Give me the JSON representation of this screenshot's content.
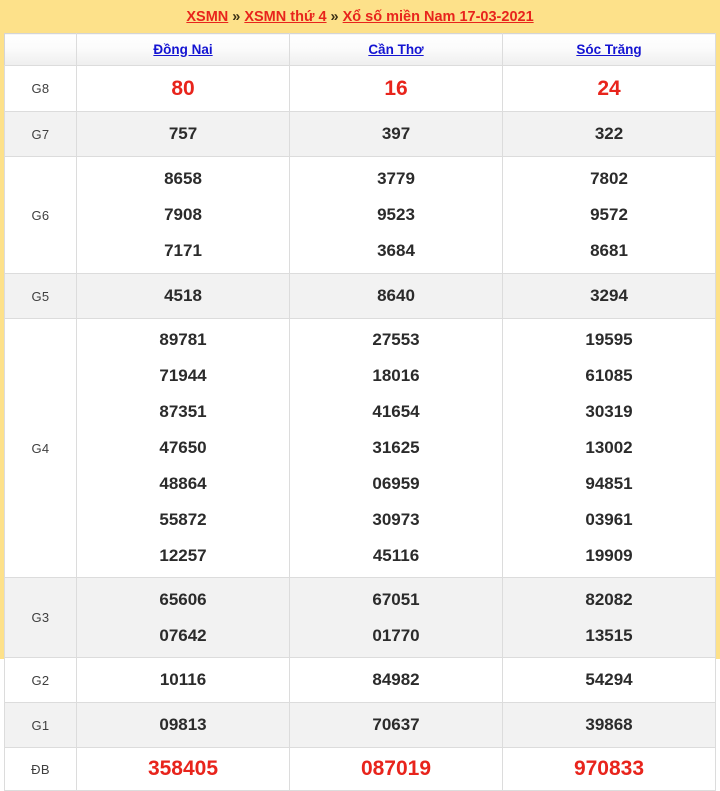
{
  "header": {
    "breadcrumb": [
      {
        "label": "XSMN",
        "type": "link"
      },
      {
        "label": "»",
        "type": "separator"
      },
      {
        "label": "XSMN thứ 4",
        "type": "link"
      },
      {
        "label": "»",
        "type": "separator"
      },
      {
        "label": "Xổ số miền Nam 17-03-2021",
        "type": "link"
      }
    ],
    "background_color": "#fde18a",
    "link_color": "#e8241c"
  },
  "table": {
    "provinces": [
      "Đồng Nai",
      "Cần Thơ",
      "Sóc Trăng"
    ],
    "province_link_color": "#1414d2",
    "highlight_color": "#e8241c",
    "rows": [
      {
        "prize": "G8",
        "highlight": true,
        "stripe": "plain",
        "values": [
          [
            "80"
          ],
          [
            "16"
          ],
          [
            "24"
          ]
        ]
      },
      {
        "prize": "G7",
        "highlight": false,
        "stripe": "alt",
        "values": [
          [
            "757"
          ],
          [
            "397"
          ],
          [
            "322"
          ]
        ]
      },
      {
        "prize": "G6",
        "highlight": false,
        "stripe": "plain",
        "values": [
          [
            "8658",
            "7908",
            "7171"
          ],
          [
            "3779",
            "9523",
            "3684"
          ],
          [
            "7802",
            "9572",
            "8681"
          ]
        ]
      },
      {
        "prize": "G5",
        "highlight": false,
        "stripe": "alt",
        "values": [
          [
            "4518"
          ],
          [
            "8640"
          ],
          [
            "3294"
          ]
        ]
      },
      {
        "prize": "G4",
        "highlight": false,
        "stripe": "plain",
        "values": [
          [
            "89781",
            "71944",
            "87351",
            "47650",
            "48864",
            "55872",
            "12257"
          ],
          [
            "27553",
            "18016",
            "41654",
            "31625",
            "06959",
            "30973",
            "45116"
          ],
          [
            "19595",
            "61085",
            "30319",
            "13002",
            "94851",
            "03961",
            "19909"
          ]
        ]
      },
      {
        "prize": "G3",
        "highlight": false,
        "stripe": "alt",
        "values": [
          [
            "65606",
            "07642"
          ],
          [
            "67051",
            "01770"
          ],
          [
            "82082",
            "13515"
          ]
        ]
      },
      {
        "prize": "G2",
        "highlight": false,
        "stripe": "plain",
        "values": [
          [
            "10116"
          ],
          [
            "84982"
          ],
          [
            "54294"
          ]
        ]
      },
      {
        "prize": "G1",
        "highlight": false,
        "stripe": "alt",
        "values": [
          [
            "09813"
          ],
          [
            "70637"
          ],
          [
            "39868"
          ]
        ]
      },
      {
        "prize": "ĐB",
        "highlight": true,
        "stripe": "plain",
        "values": [
          [
            "358405"
          ],
          [
            "087019"
          ],
          [
            "970833"
          ]
        ]
      }
    ]
  }
}
